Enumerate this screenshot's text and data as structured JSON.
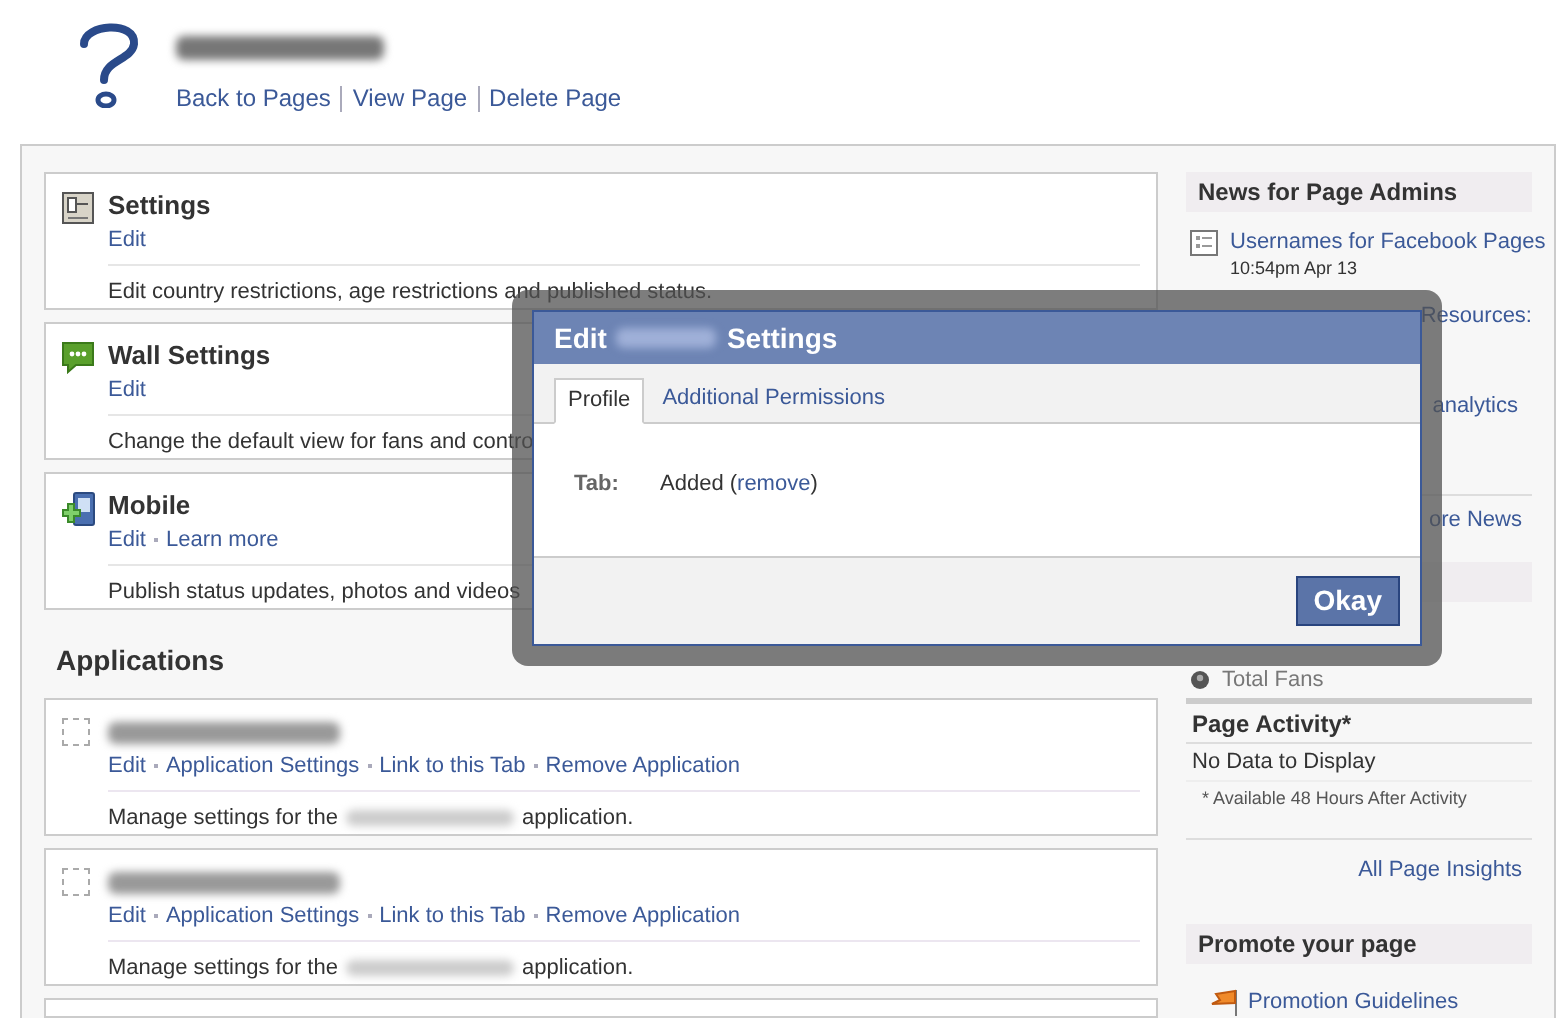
{
  "header": {
    "links": [
      "Back to Pages",
      "View Page",
      "Delete Page"
    ]
  },
  "sections": [
    {
      "kind": "settings",
      "title": "Settings",
      "links": [
        "Edit"
      ],
      "description": "Edit country restrictions, age restrictions and published status."
    },
    {
      "kind": "wall",
      "title": "Wall Settings",
      "links": [
        "Edit"
      ],
      "description": "Change the default view for fans and contro"
    },
    {
      "kind": "mobile",
      "title": "Mobile",
      "links": [
        "Edit",
        "Learn more"
      ],
      "description": "Publish status updates, photos and videos"
    }
  ],
  "applications": {
    "heading": "Applications",
    "items": [
      {
        "links": [
          "Edit",
          "Application Settings",
          "Link to this Tab",
          "Remove Application"
        ],
        "description_before": "Manage settings for the",
        "description_after": "application."
      },
      {
        "links": [
          "Edit",
          "Application Settings",
          "Link to this Tab",
          "Remove Application"
        ],
        "description_before": "Manage settings for the",
        "description_after": "application."
      }
    ]
  },
  "dialog": {
    "title_before": "Edit",
    "title_after": "Settings",
    "tabs": [
      {
        "label": "Profile",
        "selected": true
      },
      {
        "label": "Additional Permissions",
        "selected": false
      }
    ],
    "field": {
      "label": "Tab:",
      "value_before": "Added (",
      "link": "remove",
      "value_after": ")"
    },
    "button": "Okay"
  },
  "sidebar": {
    "news": {
      "heading": "News for Page Admins",
      "items": [
        {
          "title": "Usernames for Facebook Pages",
          "time": "10:54pm Apr 13"
        }
      ],
      "fragments": [
        "Resources:",
        "analytics"
      ],
      "more": "ore News"
    },
    "fans": "Total Fans",
    "activity": {
      "heading": "Page Activity*",
      "empty": "No Data to Display",
      "note": "* Available 48 Hours After Activity",
      "link": "All Page Insights"
    },
    "promote": {
      "heading": "Promote your page",
      "link": "Promotion Guidelines"
    }
  }
}
